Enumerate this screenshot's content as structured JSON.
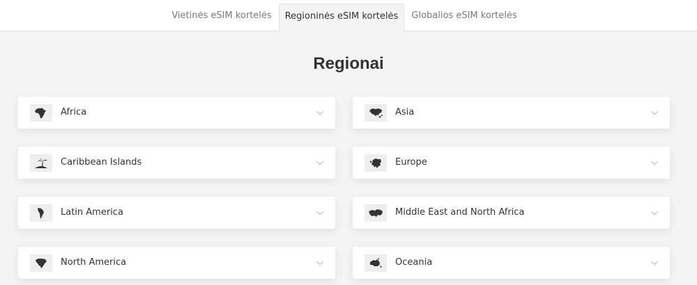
{
  "tabs": [
    {
      "label": "Vietinės eSIM kortelės",
      "active": false
    },
    {
      "label": "Regioninės eSIM kortelės",
      "active": true
    },
    {
      "label": "Globalios eSIM kortelės",
      "active": false
    }
  ],
  "page": {
    "title": "Regionai"
  },
  "regions": [
    {
      "label": "Africa",
      "icon": "africa-map-icon"
    },
    {
      "label": "Asia",
      "icon": "asia-map-icon"
    },
    {
      "label": "Caribbean Islands",
      "icon": "caribbean-island-icon"
    },
    {
      "label": "Europe",
      "icon": "europe-map-icon"
    },
    {
      "label": "Latin America",
      "icon": "latin-america-map-icon"
    },
    {
      "label": "Middle East and North Africa",
      "icon": "middle-east-map-icon"
    },
    {
      "label": "North America",
      "icon": "north-america-map-icon"
    },
    {
      "label": "Oceania",
      "icon": "oceania-map-icon"
    }
  ],
  "colors": {
    "background": "#f4f4f4",
    "card": "#ffffff",
    "text": "#333333",
    "muted_text": "#7a7a7a",
    "icon_bg": "#eeeeee"
  }
}
